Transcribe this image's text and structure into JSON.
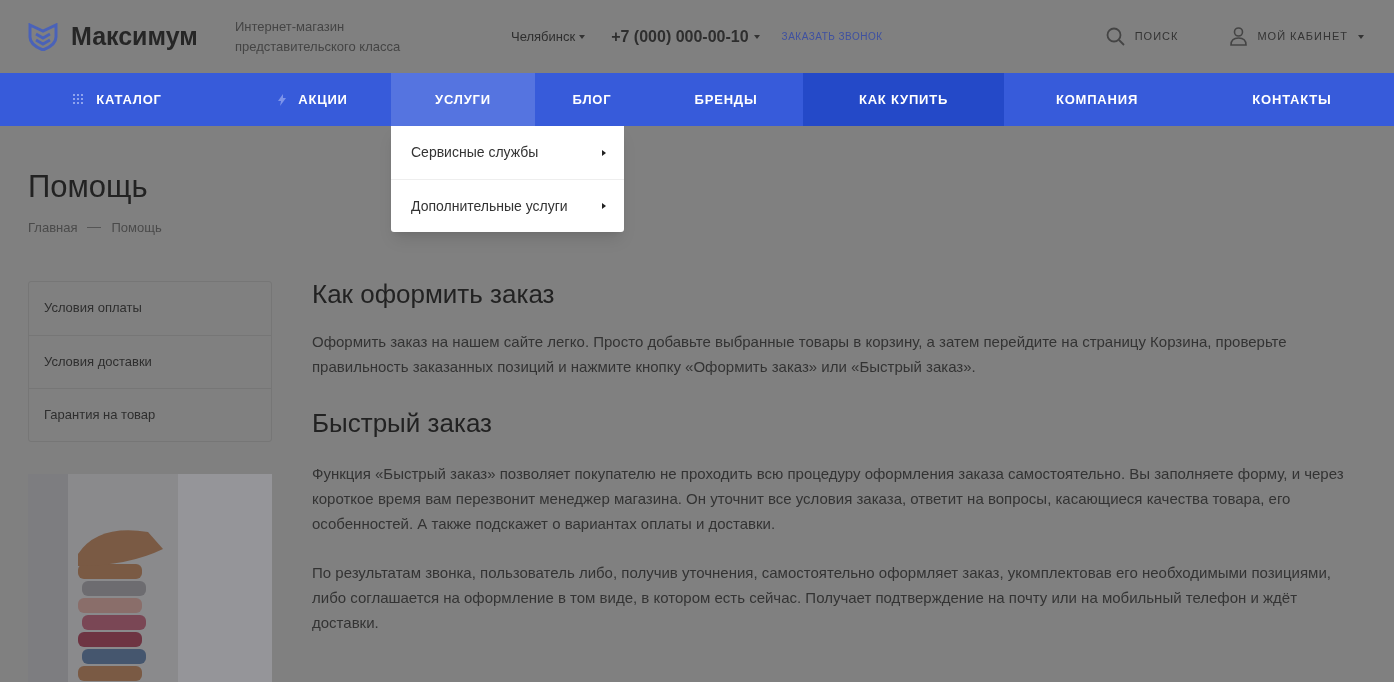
{
  "header": {
    "logo": "Максимум",
    "slogan": "Интернет-магазин представительского класса",
    "city": "Челябинск",
    "phone": "+7 (000) 000-00-10",
    "callback": "ЗАКАЗАТЬ ЗВОНОК",
    "search": "ПОИСК",
    "account": "МОЙ КАБИНЕТ"
  },
  "nav": [
    {
      "label": "КАТАЛОГ",
      "selected": false,
      "current": false
    },
    {
      "label": "АКЦИИ",
      "selected": false,
      "current": false
    },
    {
      "label": "УСЛУГИ",
      "selected": true,
      "current": false
    },
    {
      "label": "БЛОГ",
      "selected": false,
      "current": false
    },
    {
      "label": "БРЕНДЫ",
      "selected": false,
      "current": false
    },
    {
      "label": "КАК КУПИТЬ",
      "selected": false,
      "current": true
    },
    {
      "label": "КОМПАНИЯ",
      "selected": false,
      "current": false
    },
    {
      "label": "КОНТАКТЫ",
      "selected": false,
      "current": false
    }
  ],
  "dropdown": [
    "Сервисные службы",
    "Дополнительные услуги"
  ],
  "page_title": "Помощь",
  "breadcrumbs": [
    "Главная",
    "Помощь"
  ],
  "sidebar": [
    "Условия оплаты",
    "Условия доставки",
    "Гарантия на товар"
  ],
  "content": [
    {
      "kind": "heading",
      "text": "Как оформить заказ"
    },
    {
      "kind": "paragraph",
      "text": "Оформить заказ на нашем сайте легко. Просто добавьте выбранные товары в корзину, а затем перейдите на страницу Корзина, проверьте правильность заказанных позиций и нажмите кнопку «Оформить заказ» или «Быстрый заказ»."
    },
    {
      "kind": "heading",
      "text": "Быстрый заказ"
    },
    {
      "kind": "paragraph",
      "text": "Функция «Быстрый заказ» позволяет покупателю не проходить всю процедуру оформления заказа самостоятельно. Вы заполняете форму, и через короткое время вам перезвонит менеджер магазина. Он уточнит все условия заказа, ответит на вопросы, касающиеся качества товара, его особенностей. А также подскажет о вариантах оплаты и доставки."
    },
    {
      "kind": "paragraph",
      "text": "По результатам звонка, пользователь либо, получив уточнения, самостоятельно оформляет заказ, укомплектовав его необходимыми позициями, либо соглашается на оформление в том виде, в котором есть сейчас. Получает подтверждение на почту или на мобильный телефон и ждёт доставки."
    }
  ]
}
